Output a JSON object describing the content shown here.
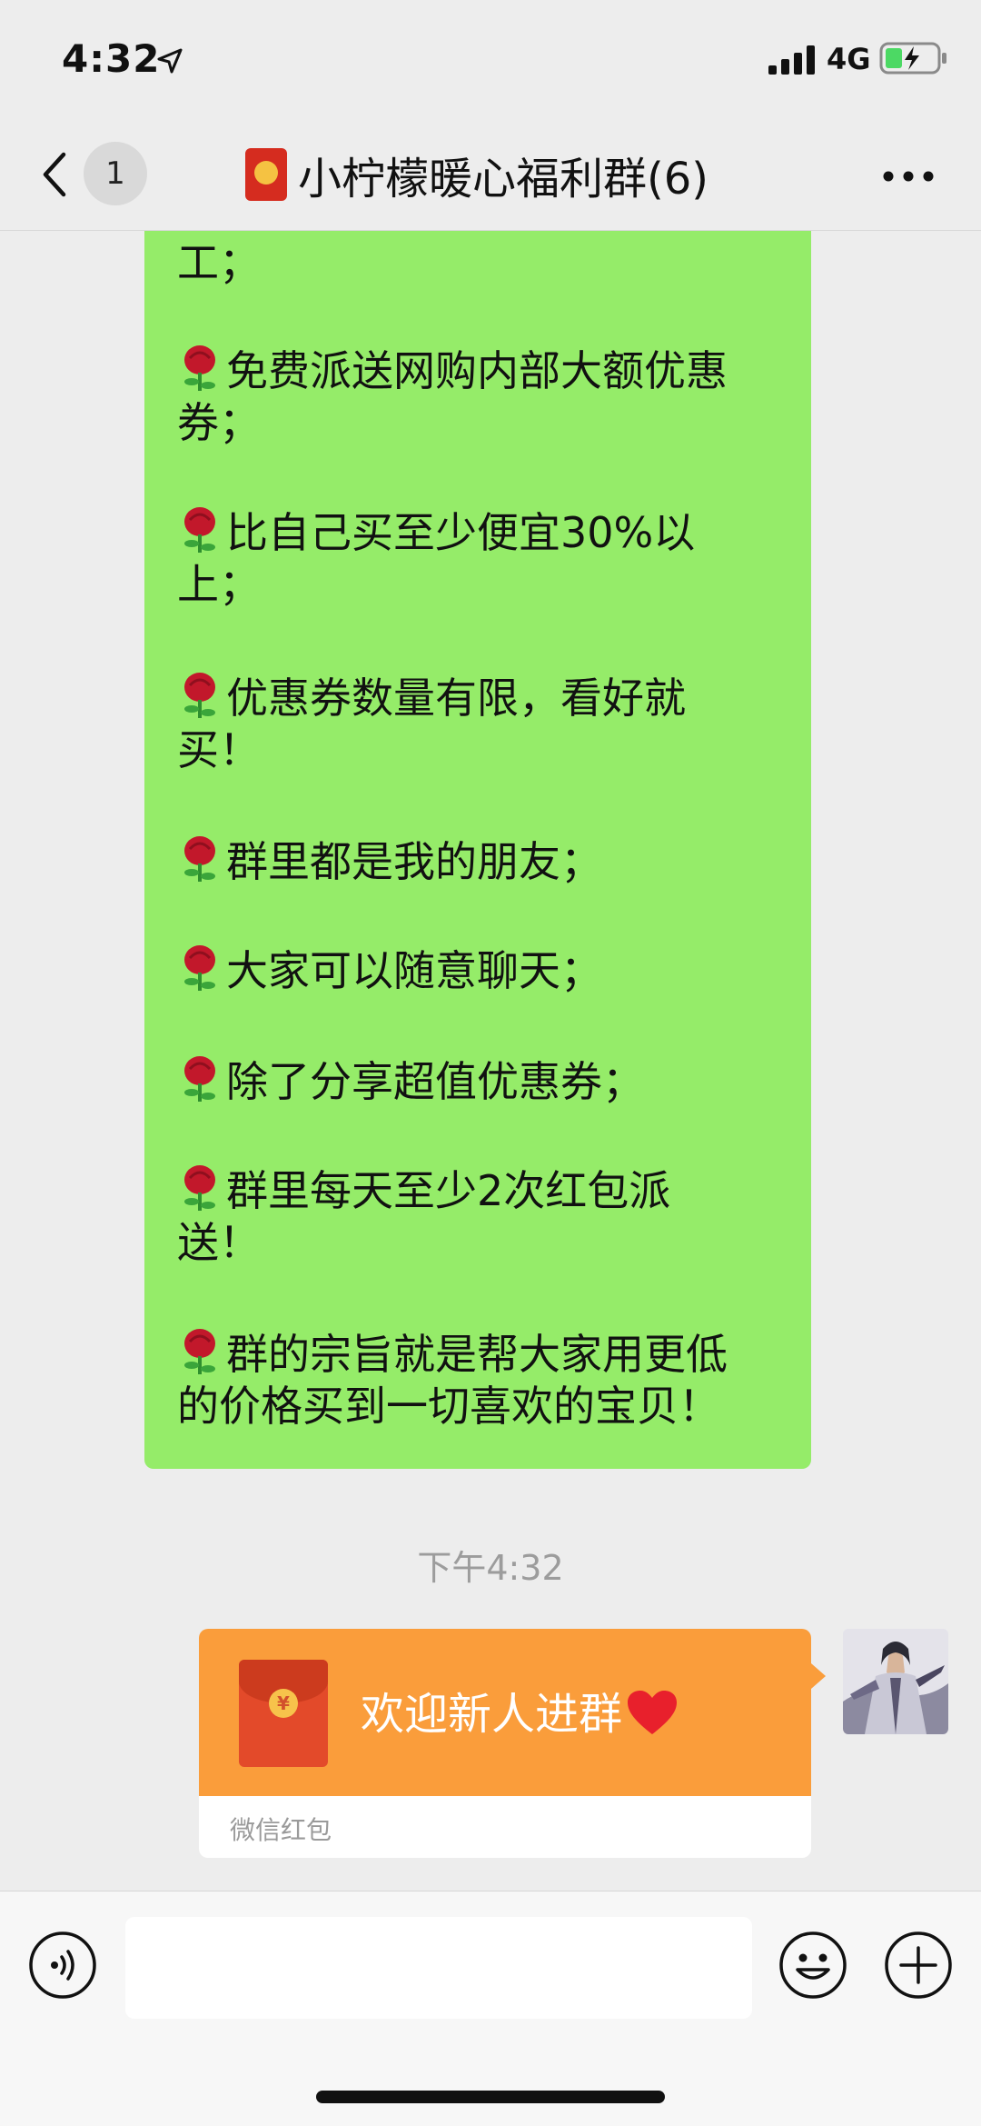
{
  "status_bar": {
    "time": "4:32",
    "network": "4G"
  },
  "nav": {
    "unread_count": "1",
    "title": "小柠檬暖心福利群(6)"
  },
  "messages": {
    "lines": [
      "工；",
      "免费派送网购内部大额优惠",
      "券；",
      "比自己买至少便宜30%以",
      "上；",
      "优惠券数量有限，看好就",
      "买！",
      "群里都是我的朋友；",
      "大家可以随意聊天；",
      "除了分享超值优惠券；",
      "群里每天至少2次红包派",
      "送！",
      "群的宗旨就是帮大家用更低",
      "的价格买到一切喜欢的宝贝！"
    ],
    "timestamp": "下午4:32",
    "red_packet": {
      "greeting": "欢迎新人进群",
      "footer": "微信红包"
    }
  },
  "input_bar": {
    "text_value": ""
  },
  "colors": {
    "bubble_green": "#95ec69",
    "red_packet_orange": "#fa9d3b",
    "background": "#ededed"
  }
}
